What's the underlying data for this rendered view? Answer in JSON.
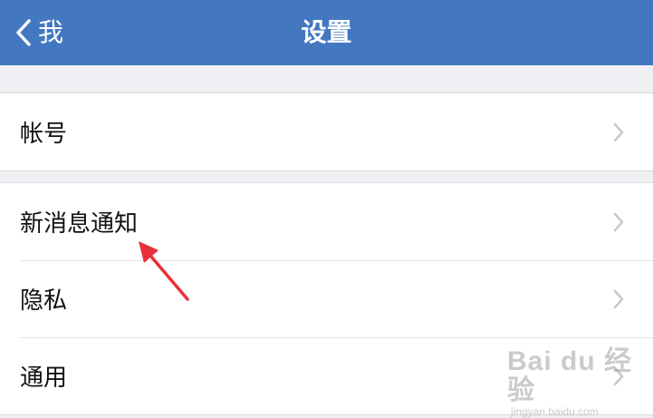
{
  "header": {
    "back_label": "我",
    "title": "设置"
  },
  "groups": [
    {
      "items": [
        {
          "label": "帐号"
        }
      ]
    },
    {
      "items": [
        {
          "label": "新消息通知"
        },
        {
          "label": "隐私"
        },
        {
          "label": "通用"
        }
      ]
    }
  ],
  "watermark": {
    "main": "Bai du 经验",
    "sub": "jingyan.baidu.com"
  },
  "colors": {
    "header_bg": "#4378c1",
    "page_bg": "#efeff4",
    "annotation": "#e8303a"
  }
}
